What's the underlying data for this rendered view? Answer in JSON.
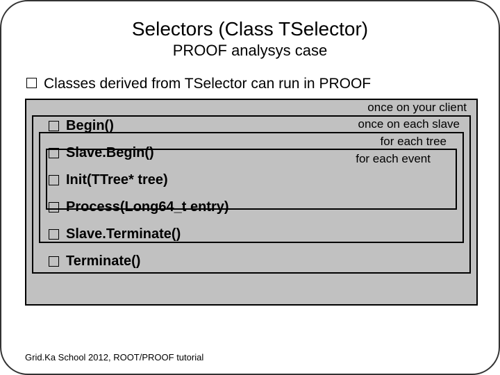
{
  "title": "Selectors (Class TSelector)",
  "subtitle": "PROOF analysys case",
  "intro": "Classes derived from TSelector can run in PROOF",
  "labels": {
    "client": "once on your client",
    "slave": "once on each slave",
    "tree": "for each tree",
    "event": "for each event"
  },
  "methods": {
    "m0": "Begin()",
    "m1": "Slave.Begin()",
    "m2": "Init(TTree* tree)",
    "m3": "Process(Long64_t entry)",
    "m4": "Slave.Terminate()",
    "m5": "Terminate()"
  },
  "footer": "Grid.Ka School 2012, ROOT/PROOF tutorial"
}
